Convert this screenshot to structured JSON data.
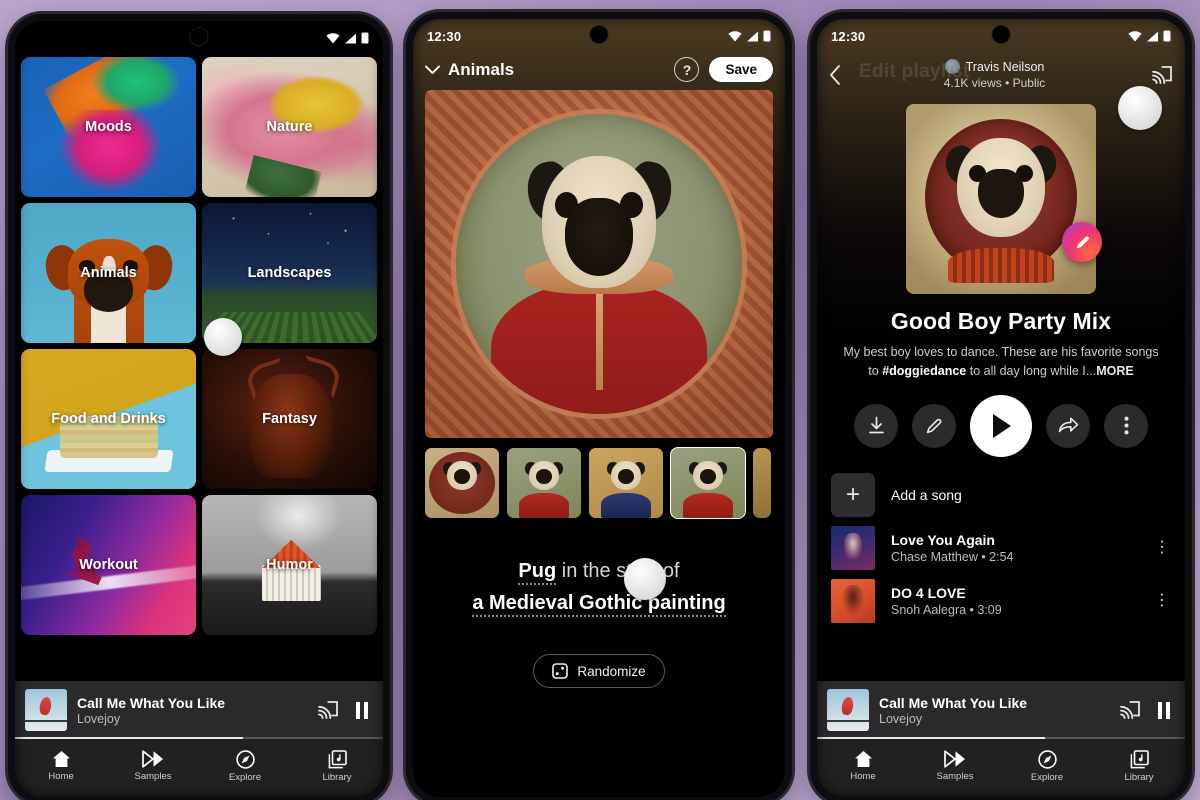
{
  "background": {
    "accent": "#a892bd"
  },
  "phone1": {
    "statusbar": {
      "time": "",
      "wifi_icon": "wifi-icon",
      "signal_icon": "signal-icon",
      "battery_icon": "battery-icon"
    },
    "grid": {
      "tiles": [
        {
          "label": "Moods",
          "art": "moods-ink-art"
        },
        {
          "label": "Nature",
          "art": "nature-peony-art"
        },
        {
          "label": "Animals",
          "art": "animals-boxer-dog-art"
        },
        {
          "label": "Landscapes",
          "art": "landscapes-field-night-art"
        },
        {
          "label": "Food and Drinks",
          "art": "food-sandwich-art"
        },
        {
          "label": "Fantasy",
          "art": "fantasy-creature-art"
        },
        {
          "label": "Workout",
          "art": "workout-runner-art"
        },
        {
          "label": "Humor",
          "art": "humor-rice-house-art"
        }
      ]
    },
    "miniplayer": {
      "title": "Call Me What You Like",
      "artist": "Lovejoy",
      "cast_icon": "cast-icon",
      "pause_icon": "pause-icon"
    },
    "nav": [
      {
        "label": "Home",
        "icon": "home-icon"
      },
      {
        "label": "Samples",
        "icon": "samples-icon"
      },
      {
        "label": "Explore",
        "icon": "explore-compass-icon"
      },
      {
        "label": "Library",
        "icon": "library-icon"
      }
    ]
  },
  "phone2": {
    "statusbar": {
      "time": "12:30",
      "wifi_icon": "wifi-icon",
      "signal_icon": "signal-icon",
      "battery_icon": "battery-icon"
    },
    "header": {
      "chevron_icon": "chevron-down-icon",
      "title": "Animals",
      "help_label": "?",
      "save_label": "Save"
    },
    "hero": {
      "alt": "pug-medieval-portrait"
    },
    "thumbnails": [
      {
        "name": "pug-variant-1",
        "selected": false
      },
      {
        "name": "pug-variant-2",
        "selected": false
      },
      {
        "name": "pug-variant-3",
        "selected": false
      },
      {
        "name": "pug-variant-4",
        "selected": true
      },
      {
        "name": "pug-variant-5",
        "selected": false
      }
    ],
    "prompt": {
      "subject": "Pug",
      "connector": " in the style of",
      "style": "a Medieval Gothic painting"
    },
    "randomize": {
      "label": "Randomize",
      "icon": "dice-icon"
    }
  },
  "phone3": {
    "statusbar": {
      "time": "12:30",
      "wifi_icon": "wifi-icon",
      "signal_icon": "signal-icon",
      "battery_icon": "battery-icon"
    },
    "header": {
      "back_icon": "back-arrow-icon",
      "ghost_title": "Edit playlist",
      "owner": "Travis Neilson",
      "meta": "4.1K views  •  Public",
      "cast_icon": "cast-icon",
      "avatar": "owner-avatar"
    },
    "artwork": {
      "alt": "pug-playlist-cover",
      "edit_badge_icon": "magic-pencil-icon"
    },
    "playlist": {
      "title": "Good Boy Party Mix",
      "description_part1": "My best boy loves to dance. These are his favorite songs to ",
      "description_tag": "#doggiedance",
      "description_part2": " to all day long while I...",
      "more_label": "MORE"
    },
    "actions": [
      {
        "name": "download-button",
        "icon": "download-icon"
      },
      {
        "name": "edit-button",
        "icon": "pencil-icon"
      },
      {
        "name": "play-button",
        "icon": "play-icon"
      },
      {
        "name": "share-button",
        "icon": "share-arrow-icon"
      },
      {
        "name": "more-button",
        "icon": "kebab-icon"
      }
    ],
    "add_song": {
      "label": "Add a song",
      "icon": "plus-icon"
    },
    "songs": [
      {
        "title": "Love You Again",
        "subtitle": "Chase Matthew  •  2:54",
        "cover": "love-you-again-cover"
      },
      {
        "title": "DO 4 LOVE",
        "subtitle": "Snoh Aalegra  •  3:09",
        "cover": "do-4-love-cover"
      }
    ],
    "miniplayer": {
      "title": "Call Me What You Like",
      "artist": "Lovejoy",
      "cast_icon": "cast-icon",
      "pause_icon": "pause-icon"
    },
    "nav": [
      {
        "label": "Home",
        "icon": "home-icon"
      },
      {
        "label": "Samples",
        "icon": "samples-icon"
      },
      {
        "label": "Explore",
        "icon": "explore-compass-icon"
      },
      {
        "label": "Library",
        "icon": "library-icon"
      }
    ]
  }
}
